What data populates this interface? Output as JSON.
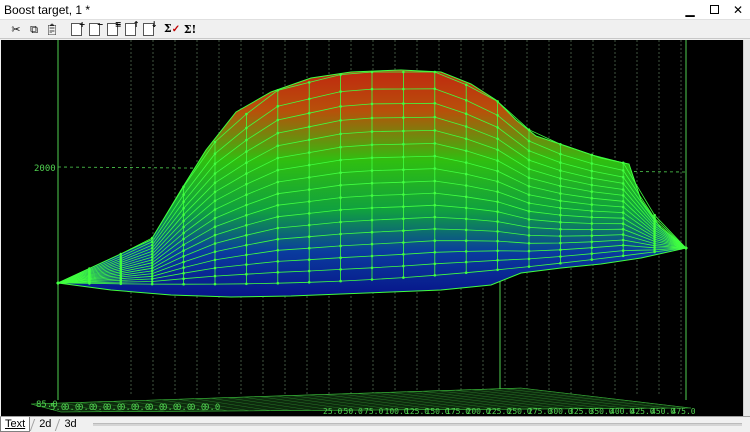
{
  "window": {
    "title": "Boost target, 1 *"
  },
  "toolbar": {
    "buttons": [
      "cut-icon",
      "copy-icon",
      "paste-icon",
      "insert-row-icon",
      "delete-row-icon",
      "insert-col-icon",
      "insert-cell-icon",
      "delete-cell-icon",
      "sum-check-icon",
      "sum-alert-icon"
    ]
  },
  "plot": {
    "z_label": "2000",
    "x_tick_labels": [
      "85.0",
      "5.0",
      "0.0",
      "0.0",
      "0.0",
      "0.0",
      "0.0",
      "0.0",
      "0.0",
      "0.0",
      "0.0",
      "0.0",
      "0.0"
    ],
    "rpm_tick_labels": [
      "25.0",
      "50.0",
      "75.0",
      "100.0",
      "125.0",
      "150.0",
      "175.0",
      "200.0",
      "225.0",
      "250.0",
      "275.0",
      "300.0",
      "325.0",
      "350.0",
      "400.0",
      "425.0",
      "450.0",
      "475.0"
    ],
    "surface_colors": {
      "low": "#0a1a9e",
      "mid": "#1fbf1f",
      "high": "#c02810",
      "grid": "#40ff40",
      "axis": "#50d050"
    }
  },
  "tabs": [
    "Text",
    "2d",
    "3d"
  ]
}
